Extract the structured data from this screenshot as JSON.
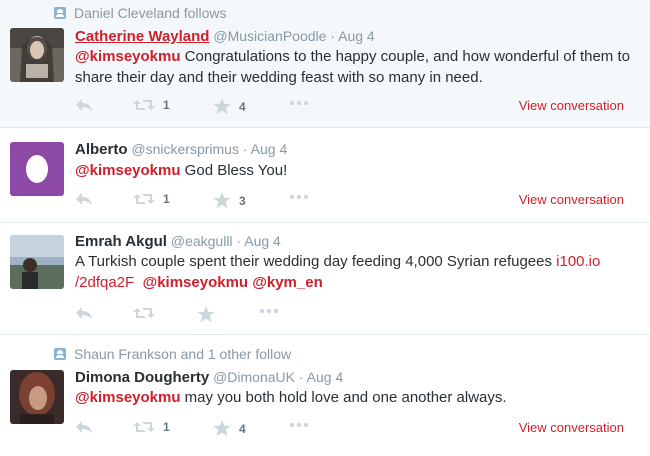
{
  "tweets": [
    {
      "context": "Daniel Cleveland follows",
      "name": "Catherine Wayland",
      "handle": "@MusicianPoodle",
      "sep": "·",
      "time": "Aug 4",
      "mention": "@kimseyokmu",
      "text": " Congratulations to the happy couple, and how wonderful of them to share their day and their wedding feast with so many in need.",
      "retweets": "1",
      "favorites": "4",
      "view": "View conversation"
    },
    {
      "name": "Alberto",
      "handle": "@snickersprimus",
      "sep": "·",
      "time": "Aug 4",
      "mention": "@kimseyokmu",
      "text": " God Bless You!",
      "retweets": "1",
      "favorites": "3",
      "view": "View conversation"
    },
    {
      "name": "Emrah Akgul",
      "handle": "@eakgulll",
      "sep": "·",
      "time": "Aug 4",
      "text_line1": "A Turkish couple spent their wedding day feeding 4,000 Syrian refugees ",
      "url_part1": "i100.io",
      "url_part2": "/2dfqa2F",
      "mention1": "@kimseyokmu",
      "mention2": "@kym_en"
    },
    {
      "context": "Shaun Frankson and 1 other follow",
      "name": "Dimona Dougherty",
      "handle": "@DimonaUK",
      "sep": "·",
      "time": "Aug 4",
      "mention": "@kimseyokmu",
      "text": " may you both hold love and one another always.",
      "retweets": "1",
      "favorites": "4",
      "view": "View conversation"
    }
  ],
  "colors": {
    "accent": "#cf1f2b",
    "muted": "#8899a6",
    "highlight_bg": "#f5f8fa"
  },
  "icons": [
    "reply-icon",
    "retweet-icon",
    "favorite-icon",
    "more-icon",
    "follow-context-icon"
  ]
}
